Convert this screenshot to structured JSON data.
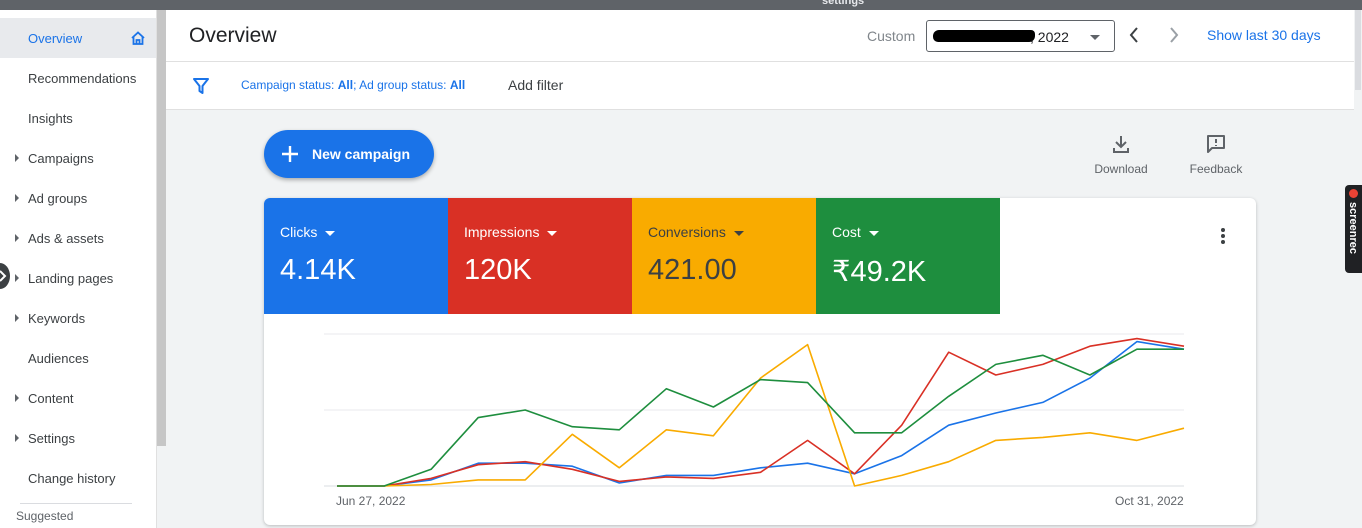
{
  "window": {
    "title_fragment": "settings"
  },
  "sidebar": {
    "items": [
      {
        "label": "Overview",
        "expandable": false,
        "active": true
      },
      {
        "label": "Recommendations",
        "expandable": false,
        "active": false
      },
      {
        "label": "Insights",
        "expandable": false,
        "active": false
      },
      {
        "label": "Campaigns",
        "expandable": true,
        "active": false
      },
      {
        "label": "Ad groups",
        "expandable": true,
        "active": false
      },
      {
        "label": "Ads & assets",
        "expandable": true,
        "active": false
      },
      {
        "label": "Landing pages",
        "expandable": true,
        "active": false
      },
      {
        "label": "Keywords",
        "expandable": true,
        "active": false
      },
      {
        "label": "Audiences",
        "expandable": false,
        "active": false
      },
      {
        "label": "Content",
        "expandable": true,
        "active": false
      },
      {
        "label": "Settings",
        "expandable": true,
        "active": false
      },
      {
        "label": "Change history",
        "expandable": false,
        "active": false
      }
    ],
    "suggested_label": "Suggested"
  },
  "header": {
    "title": "Overview",
    "date_mode": "Custom",
    "date_value": ", 2022",
    "show_last": "Show last 30 days"
  },
  "filters": {
    "campaign_status_label": "Campaign status:",
    "campaign_status_value": "All",
    "ad_group_status_label": "Ad group status:",
    "ad_group_status_value": "All",
    "add_filter": "Add filter"
  },
  "actions": {
    "new_campaign": "New campaign",
    "download": "Download",
    "feedback": "Feedback"
  },
  "metrics": [
    {
      "label": "Clicks",
      "value": "4.14K",
      "color": "#1a73e8"
    },
    {
      "label": "Impressions",
      "value": "120K",
      "color": "#d93025"
    },
    {
      "label": "Conversions",
      "value": "421.00",
      "color": "#f9ab00"
    },
    {
      "label": "Cost",
      "value": "₹49.2K",
      "color": "#1e8e3e"
    }
  ],
  "chart_data": {
    "type": "line",
    "x_start_label": "Jun 27, 2022",
    "x_end_label": "Oct 31, 2022",
    "y_range": [
      0,
      100
    ],
    "grid": true,
    "series": [
      {
        "color": "#1a73e8",
        "values": [
          0,
          0,
          4,
          15,
          15,
          13,
          2,
          7,
          7,
          12,
          15,
          8,
          20,
          40,
          48,
          55,
          71,
          95,
          90
        ]
      },
      {
        "color": "#d93025",
        "values": [
          0,
          0,
          5,
          14,
          16,
          11,
          3,
          6,
          5,
          9,
          30,
          8,
          40,
          88,
          73,
          80,
          92,
          97,
          92
        ]
      },
      {
        "color": "#f9ab00",
        "values": [
          0,
          0,
          1,
          4,
          4,
          34,
          12,
          37,
          33,
          71,
          93,
          0,
          7,
          16,
          30,
          32,
          35,
          30,
          38
        ]
      },
      {
        "color": "#1e8e3e",
        "values": [
          0,
          0,
          11,
          45,
          50,
          39,
          37,
          64,
          52,
          70,
          68,
          35,
          35,
          59,
          80,
          86,
          73,
          90,
          90
        ]
      }
    ]
  }
}
